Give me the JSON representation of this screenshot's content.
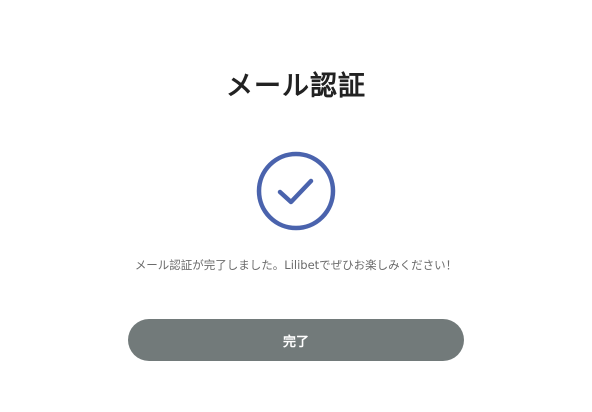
{
  "dialog": {
    "title": "メール認証",
    "message": "メール認証が完了しました。Lilibetでぜひお楽しみください！",
    "done_label": "完了"
  },
  "icons": {
    "status": "check-circle-icon"
  },
  "colors": {
    "accent": "#4a63ad",
    "button": "#727a7a",
    "title": "#222222",
    "message": "#6b6b6b"
  }
}
